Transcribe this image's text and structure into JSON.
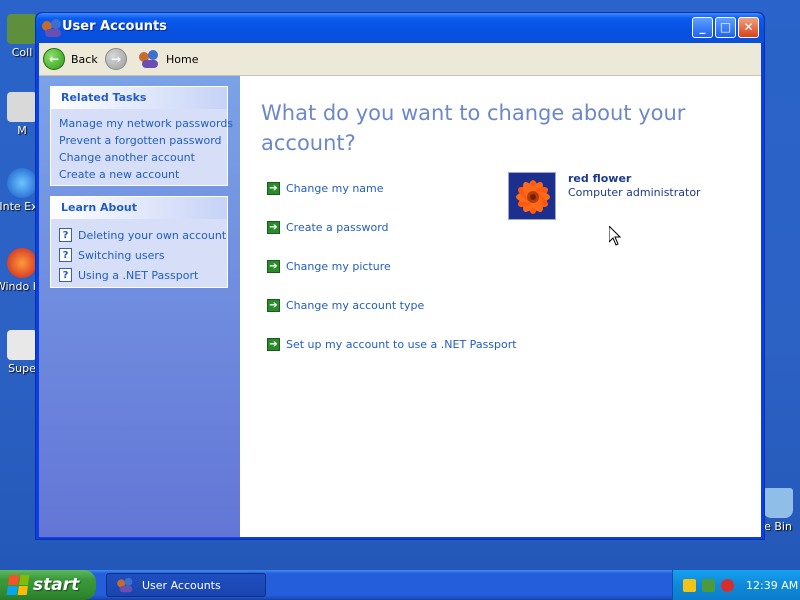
{
  "desktop": {
    "icons": [
      {
        "label": "Coll"
      },
      {
        "label": "M"
      },
      {
        "label": "Inte Exp"
      },
      {
        "label": "Windo Pla"
      },
      {
        "label": "Supe"
      },
      {
        "label": "e Bin"
      }
    ]
  },
  "window": {
    "title": "User Accounts",
    "controls": {
      "minimize": "_",
      "maximize": "□",
      "close": "✕"
    }
  },
  "toolbar": {
    "back_label": "Back",
    "home_label": "Home"
  },
  "related_tasks": {
    "header": "Related Tasks",
    "items": [
      {
        "label": "Manage my network passwords"
      },
      {
        "label": "Prevent a forgotten password"
      },
      {
        "label": "Change another account"
      },
      {
        "label": "Create a new account"
      }
    ]
  },
  "learn_about": {
    "header": "Learn About",
    "items": [
      {
        "label": "Deleting your own account"
      },
      {
        "label": "Switching users"
      },
      {
        "label": "Using a .NET Passport"
      }
    ]
  },
  "main": {
    "title": "What do you want to change about your account?",
    "options": [
      {
        "label": "Change my name"
      },
      {
        "label": "Create a password"
      },
      {
        "label": "Change my picture"
      },
      {
        "label": "Change my account type"
      },
      {
        "label": "Set up my account to use a .NET Passport"
      }
    ]
  },
  "user": {
    "name": "red flower",
    "role": "Computer administrator"
  },
  "taskbar": {
    "start_label": "start",
    "task_label": "User Accounts",
    "clock": "12:39 AM"
  },
  "colors": {
    "link": "#215dc6",
    "title_blue": "#6d88c9",
    "titlebar": "#0751e0",
    "start_green": "#3c9a3c"
  }
}
